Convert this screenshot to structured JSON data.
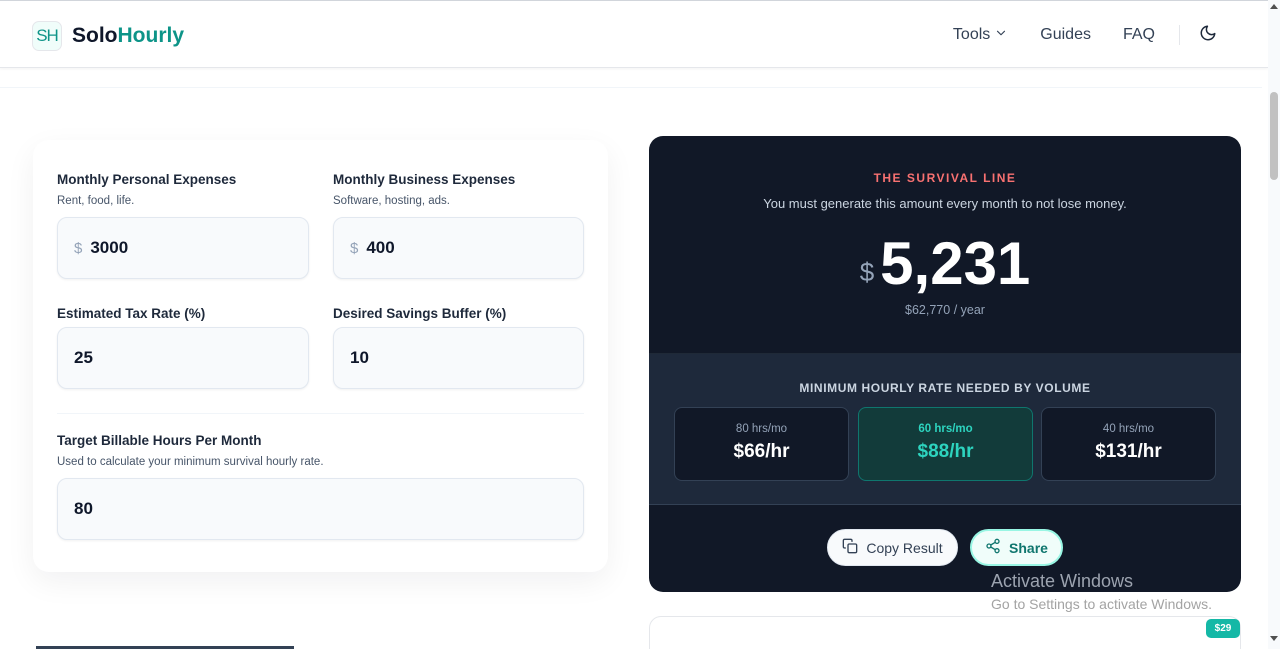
{
  "header": {
    "logo_mark": "SH",
    "brand_primary": "Solo",
    "brand_accent": "Hourly",
    "nav": {
      "tools": "Tools",
      "guides": "Guides",
      "faq": "FAQ"
    },
    "theme_icon": "moon-icon"
  },
  "form": {
    "personal": {
      "label": "Monthly Personal Expenses",
      "help": "Rent, food, life.",
      "prefix": "$",
      "value": "3000"
    },
    "business": {
      "label": "Monthly Business Expenses",
      "help": "Software, hosting, ads.",
      "prefix": "$",
      "value": "400"
    },
    "tax": {
      "label": "Estimated Tax Rate (%)",
      "value": "25"
    },
    "savings": {
      "label": "Desired Savings Buffer (%)",
      "value": "10"
    },
    "hours": {
      "label": "Target Billable Hours Per Month",
      "help": "Used to calculate your minimum survival hourly rate.",
      "value": "80"
    }
  },
  "result": {
    "eyebrow": "THE SURVIVAL LINE",
    "subtitle": "You must generate this amount every month to not lose money.",
    "currency": "$",
    "monthly": "5,231",
    "yearly": "$62,770 / year",
    "panel_title": "MINIMUM HOURLY RATE NEEDED BY VOLUME",
    "rates": [
      {
        "hours": "80 hrs/mo",
        "rate": "$66/hr"
      },
      {
        "hours": "60 hrs/mo",
        "rate": "$88/hr"
      },
      {
        "hours": "40 hrs/mo",
        "rate": "$131/hr"
      }
    ],
    "copy_label": "Copy Result",
    "share_label": "Share"
  },
  "watermark": {
    "title": "Activate Windows",
    "subtitle": "Go to Settings to activate Windows."
  },
  "badge": {
    "price": "$29"
  },
  "colors": {
    "accent": "#0d9488",
    "result_bg": "#111827",
    "alert": "#f87171",
    "highlight": "#2dd4bf"
  }
}
